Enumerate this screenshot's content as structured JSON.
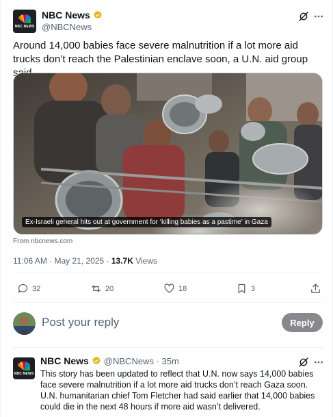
{
  "tweet": {
    "display_name": "NBC News",
    "handle": "@NBCNews",
    "avatar_logo_text": "NBC NEWS",
    "text": "Around 14,000 babies face severe malnutrition if a lot more aid trucks don’t reach the Palestinian enclave soon, a U.N. aid group said.",
    "media": {
      "caption": "Ex-Israeli general hits out at government for ‘killing babies as a pastime’ in Gaza",
      "source": "From nbcnews.com"
    },
    "timestamp": "11:06 AM · May 21, 2025 · ",
    "views_count": "13.7K",
    "views_label": " Views",
    "actions": {
      "replies": "32",
      "reposts": "20",
      "likes": "18",
      "bookmarks": "3"
    }
  },
  "composer": {
    "placeholder": "Post your reply",
    "button_label": "Reply"
  },
  "reply": {
    "display_name": "NBC News",
    "handle_time": "@NBCNews · 35m",
    "text": "This story has been updated to reflect that U.N. now says 14,000 babies face severe malnutrition if a lot more aid trucks don’t reach Gaza soon. U.N. humanitarian chief Tom Fletcher had said earlier that 14,000 babies could die in the next 48 hours if more aid wasn’t delivered."
  },
  "icons": {
    "verified": "verified-badge-icon",
    "grok": "grok-icon",
    "more": "more-icon",
    "reply": "reply-icon",
    "repost": "repost-icon",
    "like": "heart-icon",
    "bookmark": "bookmark-icon",
    "share": "share-icon"
  },
  "colors": {
    "verified_gold": "#e2b719",
    "text_primary": "#0f1419",
    "text_secondary": "#536471",
    "reply_button": "#87898c",
    "divider": "#eff3f4"
  }
}
